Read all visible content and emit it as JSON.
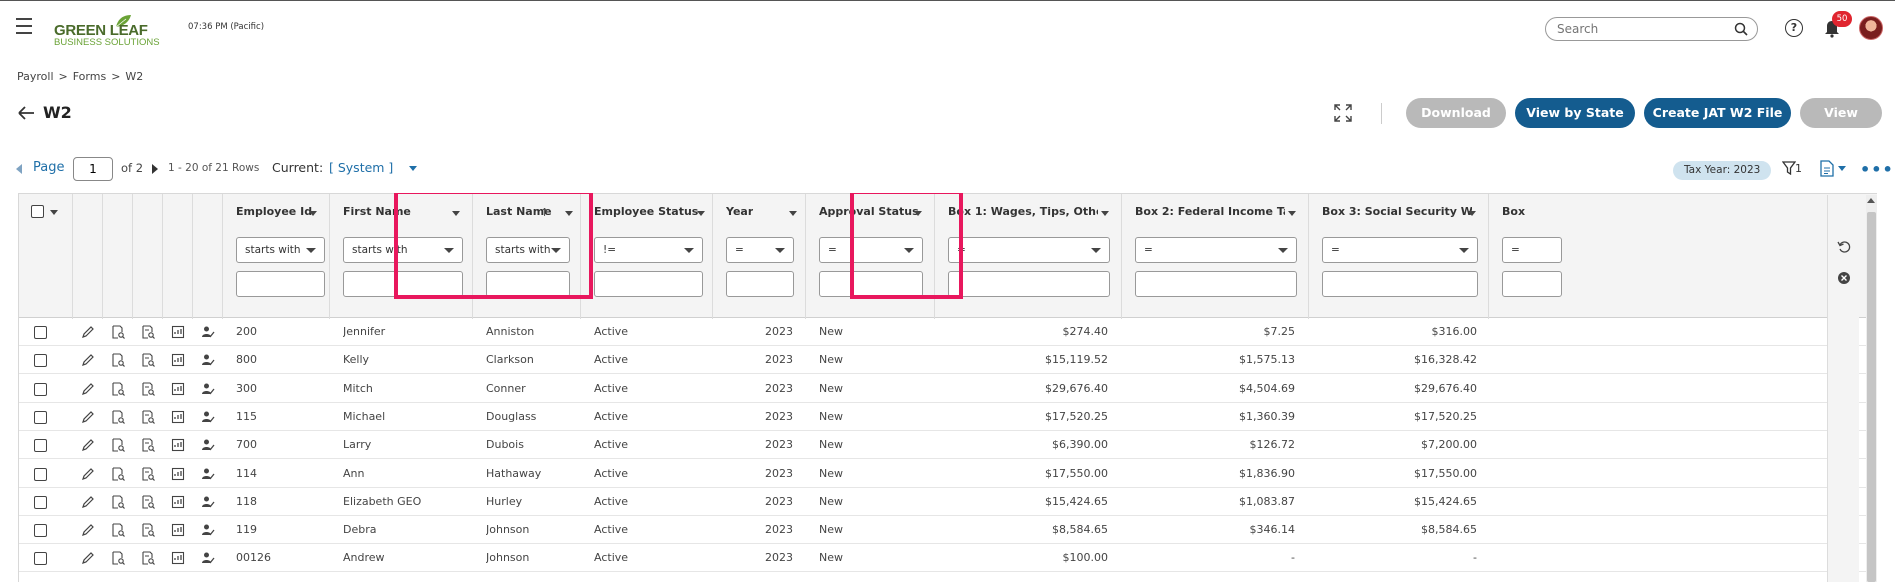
{
  "header": {
    "logo_line1": "GREEN LEAF",
    "logo_line2": "BUSINESS SOLUTIONS",
    "clock": "07:36 PM (Pacific)",
    "search_placeholder": "Search",
    "help_icon": "?",
    "notification_count": "50"
  },
  "breadcrumb": [
    "Payroll",
    "Forms",
    "W2"
  ],
  "breadcrumb_separator": ">",
  "page_title": "W2",
  "toolbar": {
    "download_label": "Download",
    "view_by_state_label": "View by State",
    "create_jat_label": "Create JAT W2 File",
    "view_label": "View",
    "colors": {
      "primary": "#145c8f",
      "disabled": "#b9b9b9",
      "highlight": "#e8175d"
    }
  },
  "pager": {
    "page_label": "Page",
    "page_value": "1",
    "of_label": "of 2",
    "rows_label": "1 - 20 of 21 Rows",
    "current_label": "Current:",
    "current_view": "[ System ]"
  },
  "tax_year_badge": "Tax Year: 2023",
  "filter_count": "1",
  "more_icon": "•••",
  "columns": [
    {
      "key": "employee_id",
      "title": "Employee Id",
      "operator": "starts with"
    },
    {
      "key": "first_name",
      "title": "First Name",
      "operator": "starts with"
    },
    {
      "key": "last_name",
      "title": "Last Name",
      "operator": "starts with",
      "sort": "↑"
    },
    {
      "key": "status",
      "title": "Employee Status",
      "operator": "!="
    },
    {
      "key": "year",
      "title": "Year",
      "operator": "="
    },
    {
      "key": "approval",
      "title": "Approval Status",
      "operator": "="
    },
    {
      "key": "box1",
      "title": "Box 1: Wages, Tips, Other C...",
      "operator": "="
    },
    {
      "key": "box2",
      "title": "Box 2: Federal Income Tax ...",
      "operator": "="
    },
    {
      "key": "box3",
      "title": "Box 3: Social Security Wages",
      "operator": "="
    },
    {
      "key": "box4",
      "title": "Box",
      "operator": "="
    }
  ],
  "rows": [
    {
      "employee_id": "200",
      "first_name": "Jennifer",
      "last_name": "Anniston",
      "status": "Active",
      "year": "2023",
      "approval": "New",
      "box1": "$274.40",
      "box2": "$7.25",
      "box3": "$316.00"
    },
    {
      "employee_id": "800",
      "first_name": "Kelly",
      "last_name": "Clarkson",
      "status": "Active",
      "year": "2023",
      "approval": "New",
      "box1": "$15,119.52",
      "box2": "$1,575.13",
      "box3": "$16,328.42"
    },
    {
      "employee_id": "300",
      "first_name": "Mitch",
      "last_name": "Conner",
      "status": "Active",
      "year": "2023",
      "approval": "New",
      "box1": "$29,676.40",
      "box2": "$4,504.69",
      "box3": "$29,676.40"
    },
    {
      "employee_id": "115",
      "first_name": "Michael",
      "last_name": "Douglass",
      "status": "Active",
      "year": "2023",
      "approval": "New",
      "box1": "$17,520.25",
      "box2": "$1,360.39",
      "box3": "$17,520.25"
    },
    {
      "employee_id": "700",
      "first_name": "Larry",
      "last_name": "Dubois",
      "status": "Active",
      "year": "2023",
      "approval": "New",
      "box1": "$6,390.00",
      "box2": "$126.72",
      "box3": "$7,200.00"
    },
    {
      "employee_id": "114",
      "first_name": "Ann",
      "last_name": "Hathaway",
      "status": "Active",
      "year": "2023",
      "approval": "New",
      "box1": "$17,550.00",
      "box2": "$1,836.90",
      "box3": "$17,550.00"
    },
    {
      "employee_id": "118",
      "first_name": "Elizabeth GEO",
      "last_name": "Hurley",
      "status": "Active",
      "year": "2023",
      "approval": "New",
      "box1": "$15,424.65",
      "box2": "$1,083.87",
      "box3": "$15,424.65"
    },
    {
      "employee_id": "119",
      "first_name": "Debra",
      "last_name": "Johnson",
      "status": "Active",
      "year": "2023",
      "approval": "New",
      "box1": "$8,584.65",
      "box2": "$346.14",
      "box3": "$8,584.65"
    },
    {
      "employee_id": "00126",
      "first_name": "Andrew",
      "last_name": "Johnson",
      "status": "Active",
      "year": "2023",
      "approval": "New",
      "box1": "$100.00",
      "box2": "-",
      "box3": "-"
    }
  ],
  "row_icons": [
    "pencil-icon",
    "form-search-icon",
    "document-search-icon",
    "report-icon",
    "user-edit-icon"
  ]
}
